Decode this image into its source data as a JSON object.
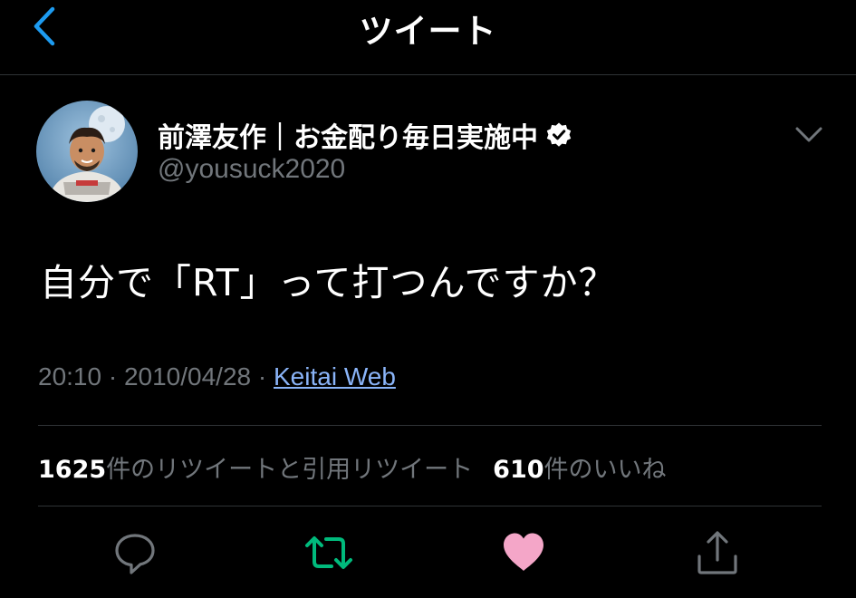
{
  "header": {
    "title": "ツイート"
  },
  "tweet": {
    "display_name": "前澤友作｜お金配り毎日実施中",
    "handle": "@yousuck2020",
    "verified": true,
    "text": "自分で「RT」って打つんですか？",
    "time": "20:10",
    "date": "2010/04/28",
    "separator": "·",
    "source": "Keitai Web"
  },
  "stats": {
    "retweets_count": "1625",
    "retweets_label": "件のリツイートと引用リツイート",
    "likes_count": "610",
    "likes_label": "件のいいね"
  },
  "colors": {
    "background": "#000000",
    "accent_blue": "#1d9bf0",
    "retweet_green": "#00ba7c",
    "like_pink": "#f4a6c8",
    "secondary_text": "#71767b"
  },
  "icons": {
    "back": "chevron-left-icon",
    "verified": "verified-badge-icon",
    "more": "chevron-down-icon",
    "reply": "reply-icon",
    "retweet": "retweet-icon",
    "like": "heart-icon",
    "share": "share-icon"
  },
  "actions": {
    "retweeted": true,
    "liked": true
  }
}
